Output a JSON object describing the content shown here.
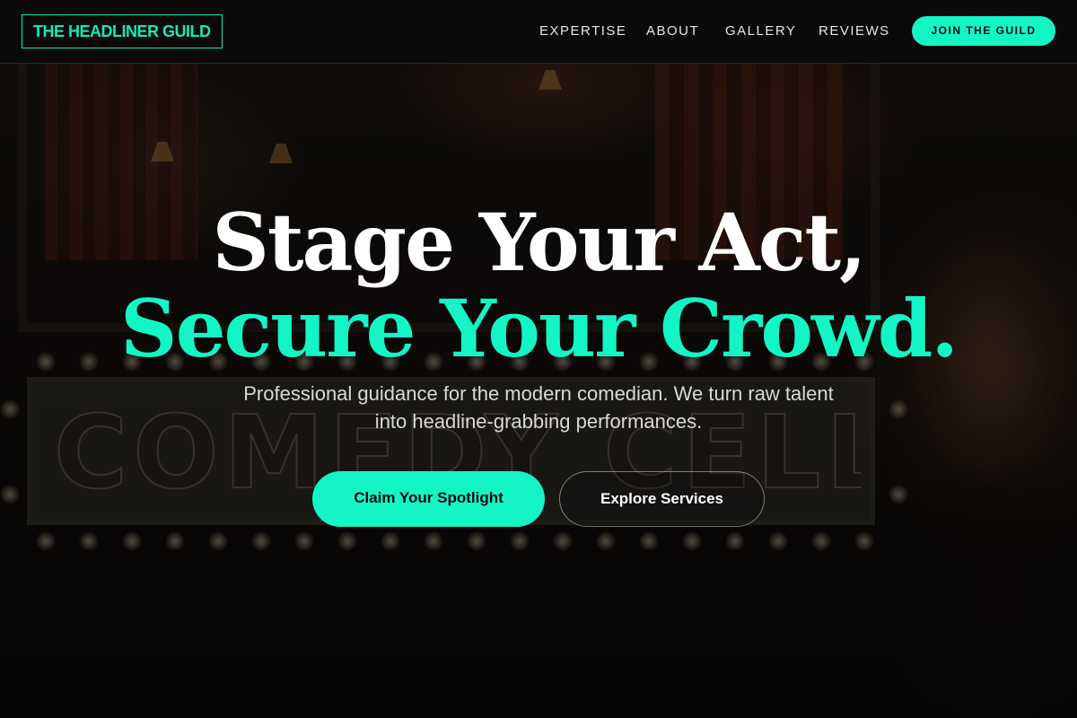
{
  "brand": {
    "logo_text": "THE HEADLINER GUILD",
    "accent_color": "#14f5c6"
  },
  "nav": {
    "items": [
      {
        "label": "EXPERTISE"
      },
      {
        "label": "ABOUT"
      },
      {
        "label": "GALLERY"
      },
      {
        "label": "REVIEWS"
      }
    ],
    "cta_label": "JOIN THE GUILD"
  },
  "hero": {
    "headline_line1": "Stage Your Act,",
    "headline_line2": "Secure Your Crowd.",
    "subtext": "Professional guidance for the modern comedian. We turn raw talent into headline-grabbing performances.",
    "primary_button": "Claim Your Spotlight",
    "secondary_button": "Explore Services",
    "background_sign_text": "COMEDY CELLAR"
  }
}
